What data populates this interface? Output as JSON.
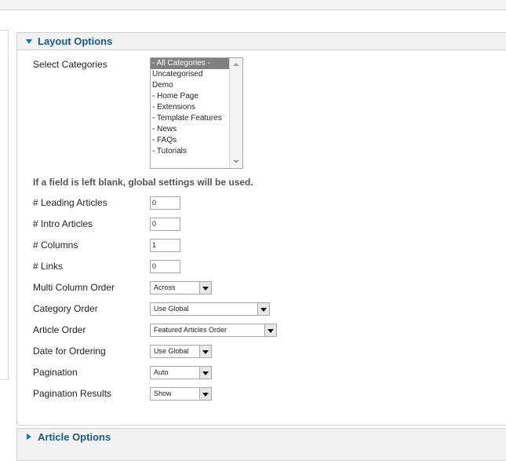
{
  "layout_panel": {
    "title": "Layout Options",
    "select_categories_label": "Select Categories",
    "categories": [
      "- All Categories -",
      "Uncategorised",
      "Demo",
      "- Home Page",
      "- Extensions",
      "- Template Features",
      "- News",
      "- FAQs",
      "- Tutorials"
    ],
    "selected_category": "- All Categories -",
    "hint": "If a field is left blank, global settings will be used.",
    "fields": {
      "leading_label": "# Leading Articles",
      "leading_value": "0",
      "intro_label": "# Intro Articles",
      "intro_value": "0",
      "columns_label": "# Columns",
      "columns_value": "1",
      "links_label": "# Links",
      "links_value": "0",
      "multi_column_label": "Multi Column Order",
      "multi_column_value": "Across",
      "category_order_label": "Category Order",
      "category_order_value": "Use Global",
      "article_order_label": "Article Order",
      "article_order_value": "Featured Articles Order",
      "date_ordering_label": "Date for Ordering",
      "date_ordering_value": "Use Global",
      "pagination_label": "Pagination",
      "pagination_value": "Auto",
      "pagination_results_label": "Pagination Results",
      "pagination_results_value": "Show"
    }
  },
  "article_panel": {
    "title": "Article Options"
  },
  "colors": {
    "title": "#1a5a86",
    "arrow": "#1a73a8",
    "selected_bg": "#808080"
  },
  "icons": {
    "expanded": "chevron-down-icon",
    "collapsed": "chevron-right-icon"
  }
}
